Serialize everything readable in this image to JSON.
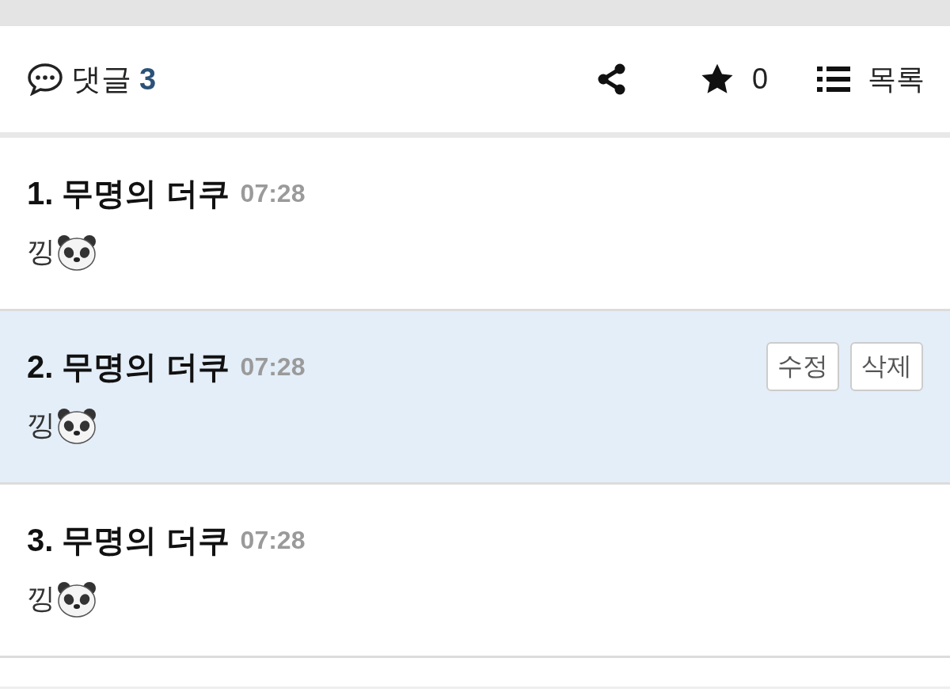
{
  "header": {
    "comments_label": "댓글",
    "comments_count": "3",
    "likes": "0",
    "list_label": "목록"
  },
  "comments": [
    {
      "number": "1.",
      "author": "무명의 더쿠",
      "time": "07:28",
      "text": "낑",
      "selected": false
    },
    {
      "number": "2.",
      "author": "무명의 더쿠",
      "time": "07:28",
      "text": "낑",
      "selected": true,
      "actions": [
        "수정",
        "삭제"
      ]
    },
    {
      "number": "3.",
      "author": "무명의 더쿠",
      "time": "07:28",
      "text": "낑",
      "selected": false
    }
  ]
}
